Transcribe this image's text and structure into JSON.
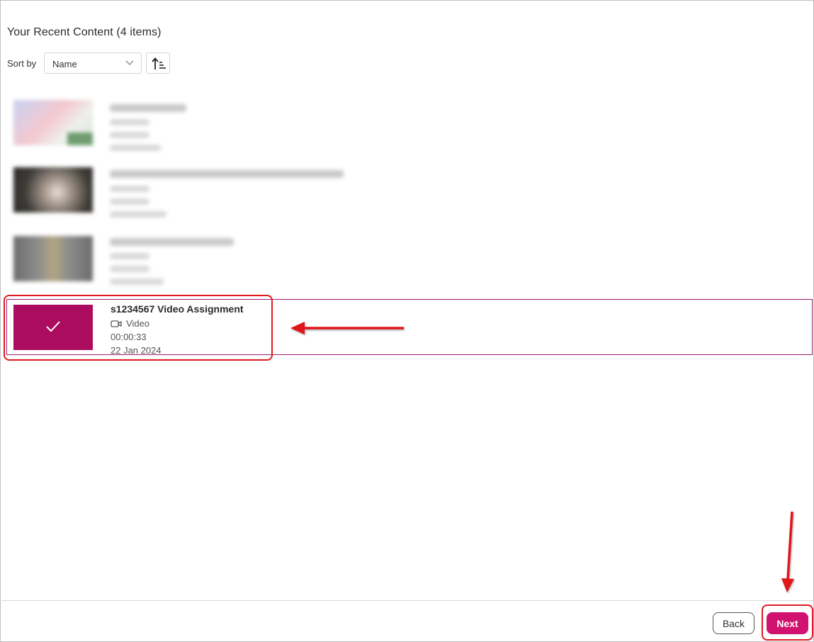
{
  "header": {
    "title": "Your Recent Content (4 items)"
  },
  "sort": {
    "label": "Sort by",
    "selected": "Name",
    "order_icon": "sort-ascending-icon"
  },
  "items": [
    {
      "blurred": true
    },
    {
      "blurred": true
    },
    {
      "blurred": true
    },
    {
      "blurred": false,
      "title": "s1234567 Video Assignment",
      "type": "Video",
      "duration": "00:00:33",
      "date": "22 Jan 2024",
      "selected": true,
      "check_icon": "checkmark-icon"
    }
  ],
  "footer": {
    "back_label": "Back",
    "next_label": "Next"
  },
  "colors": {
    "accent": "#d1126e",
    "selected_thumb": "#ab0c5e",
    "annotation": "#e0191f"
  }
}
